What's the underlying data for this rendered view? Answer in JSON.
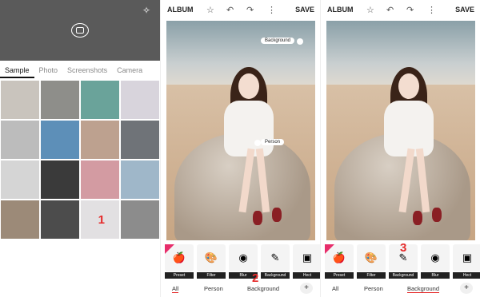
{
  "panel1": {
    "tabs": [
      "Sample",
      "Photo",
      "Screenshots",
      "Camera"
    ],
    "active_tab": "Sample",
    "grid_colors": [
      "#c9c4bd",
      "#8e8e8a",
      "#6aa39a",
      "#d8d4dc",
      "#bcbcbc",
      "#5d8fb8",
      "#bda18f",
      "#6f7378",
      "#d5d5d5",
      "#3a3a3a",
      "#d39ba2",
      "#9fb7c9",
      "#9c8a78",
      "#4c4c4c",
      "#e2e0e2",
      "#8c8c8c"
    ],
    "step_number": "1"
  },
  "panel2": {
    "album": "ALBUM",
    "save": "SAVE",
    "tags": {
      "background": "Background",
      "person": "Person"
    },
    "effects": [
      "Preset",
      "Filter",
      "Blur",
      "Background",
      "Hect"
    ],
    "bottom_tabs": {
      "all": "All",
      "person": "Person",
      "background": "Background"
    },
    "plus": "+",
    "step_number": "2"
  },
  "panel3": {
    "album": "ALBUM",
    "save": "SAVE",
    "effects": [
      "Preset",
      "Filter",
      "Background",
      "Blur",
      "Hect"
    ],
    "bottom_tabs": {
      "all": "All",
      "person": "Person",
      "background": "Background"
    },
    "plus": "+",
    "step_number": "3"
  },
  "colors": {
    "accent": "#e52a2a",
    "new_badge": "#e72e6b",
    "header_bg": "#5a5a5a"
  }
}
